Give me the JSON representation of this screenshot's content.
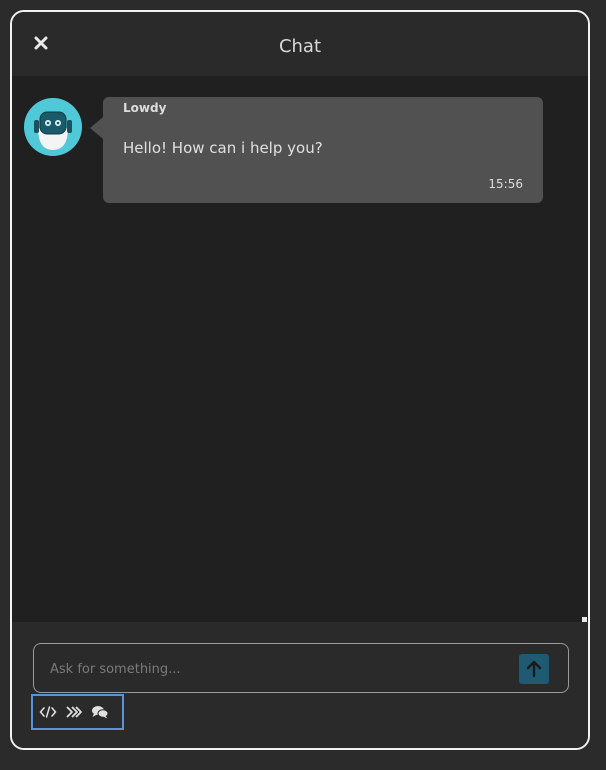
{
  "header": {
    "title": "Chat",
    "close_icon": "close-icon"
  },
  "message": {
    "sender": "Lowdy",
    "text": "Hello! How can i help you?",
    "time": "15:56",
    "avatar_icon": "robot-avatar-icon"
  },
  "composer": {
    "placeholder": "Ask for something...",
    "send_icon": "arrow-up-icon"
  },
  "toolbar": {
    "icons": [
      "code-icon",
      "chevrons-right-icon",
      "comments-icon"
    ]
  },
  "colors": {
    "background": "#202020",
    "panel": "#2a2a2a",
    "bubble": "#515151",
    "accent": "#1f5a72",
    "avatar_teal": "#4fc8d8",
    "highlight_border": "#5a94d6"
  }
}
